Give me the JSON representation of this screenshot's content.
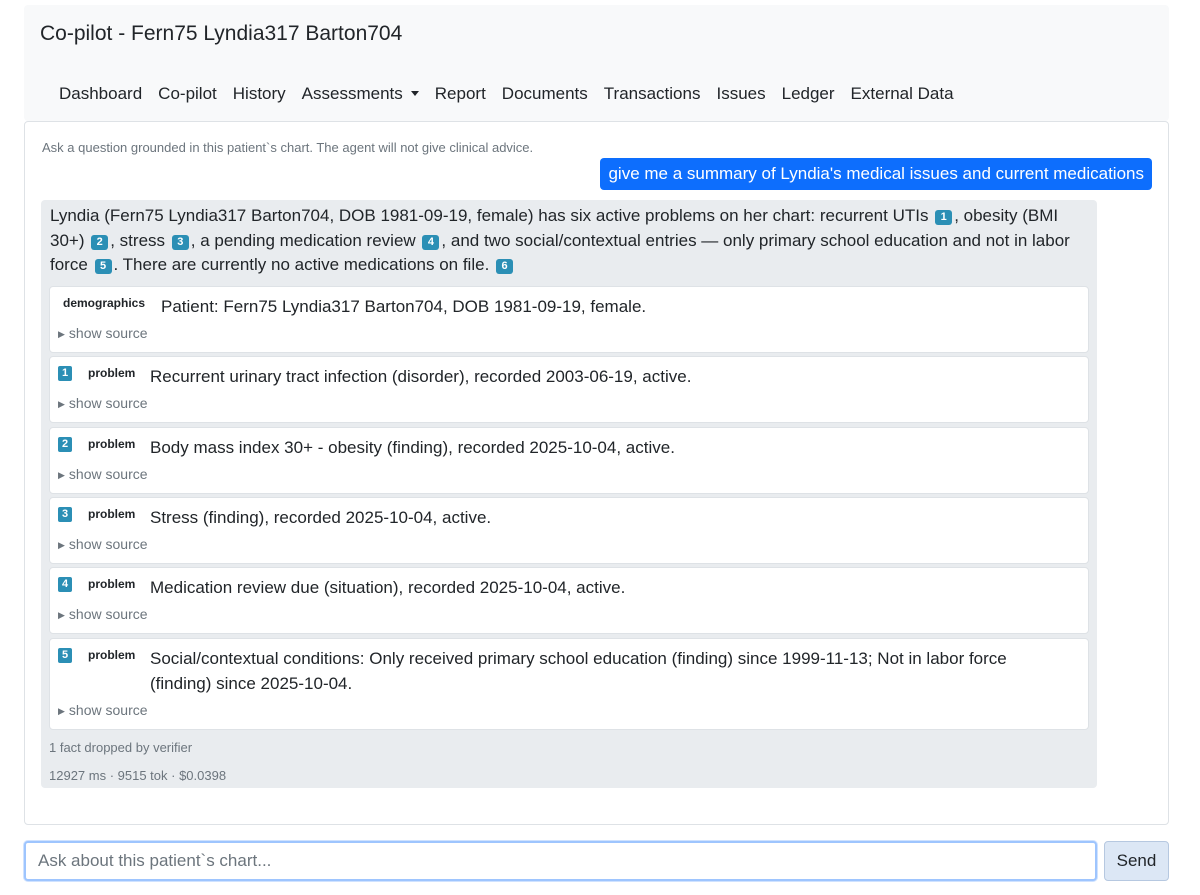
{
  "app": {
    "title": "Co-pilot - Fern75 Lyndia317 Barton704"
  },
  "nav": {
    "items": [
      "Dashboard",
      "Co-pilot",
      "History",
      "Assessments",
      "Report",
      "Documents",
      "Transactions",
      "Issues",
      "Ledger",
      "External Data"
    ]
  },
  "chat": {
    "hint": "Ask a question grounded in this patient`s chart. The agent will not give clinical advice.",
    "user_message": "give me a summary of Lyndia's medical issues and current medications",
    "answer": {
      "seg0": "Lyndia (Fern75 Lyndia317 Barton704, DOB 1981-09-19, female) has six active problems on her chart: recurrent UTIs",
      "c1": "1",
      "seg1": ", obesity (BMI 30+)",
      "c2": "2",
      "seg2": ", stress",
      "c3": "3",
      "seg3": ", a pending medication review",
      "c4": "4",
      "seg4": ", and two social/contextual entries — only primary school education and not in labor force",
      "c5": "5",
      "seg5": ". There are currently no active medications on file.",
      "c6": "6"
    },
    "facts": [
      {
        "num": "",
        "type": "demographics",
        "text": "Patient: Fern75 Lyndia317 Barton704, DOB 1981-09-19, female.",
        "source_label": "show source"
      },
      {
        "num": "1",
        "type": "problem",
        "text": "Recurrent urinary tract infection (disorder), recorded 2003-06-19, active.",
        "source_label": "show source"
      },
      {
        "num": "2",
        "type": "problem",
        "text": "Body mass index 30+ - obesity (finding), recorded 2025-10-04, active.",
        "source_label": "show source"
      },
      {
        "num": "3",
        "type": "problem",
        "text": "Stress (finding), recorded 2025-10-04, active.",
        "source_label": "show source"
      },
      {
        "num": "4",
        "type": "problem",
        "text": "Medication review due (situation), recorded 2025-10-04, active.",
        "source_label": "show source"
      },
      {
        "num": "5",
        "type": "problem",
        "text": "Social/contextual conditions: Only received primary school education (finding) since 1999-11-13; Not in labor force (finding) since 2025-10-04.",
        "source_label": "show source"
      }
    ],
    "verifier_note": "1 fact dropped by verifier",
    "stats": "12927 ms · 9515 tok · $0.0398"
  },
  "composer": {
    "placeholder": "Ask about this patient`s chart...",
    "send_label": "Send"
  },
  "colors": {
    "accent": "#0d6efd",
    "citation": "#2b8fb5"
  }
}
